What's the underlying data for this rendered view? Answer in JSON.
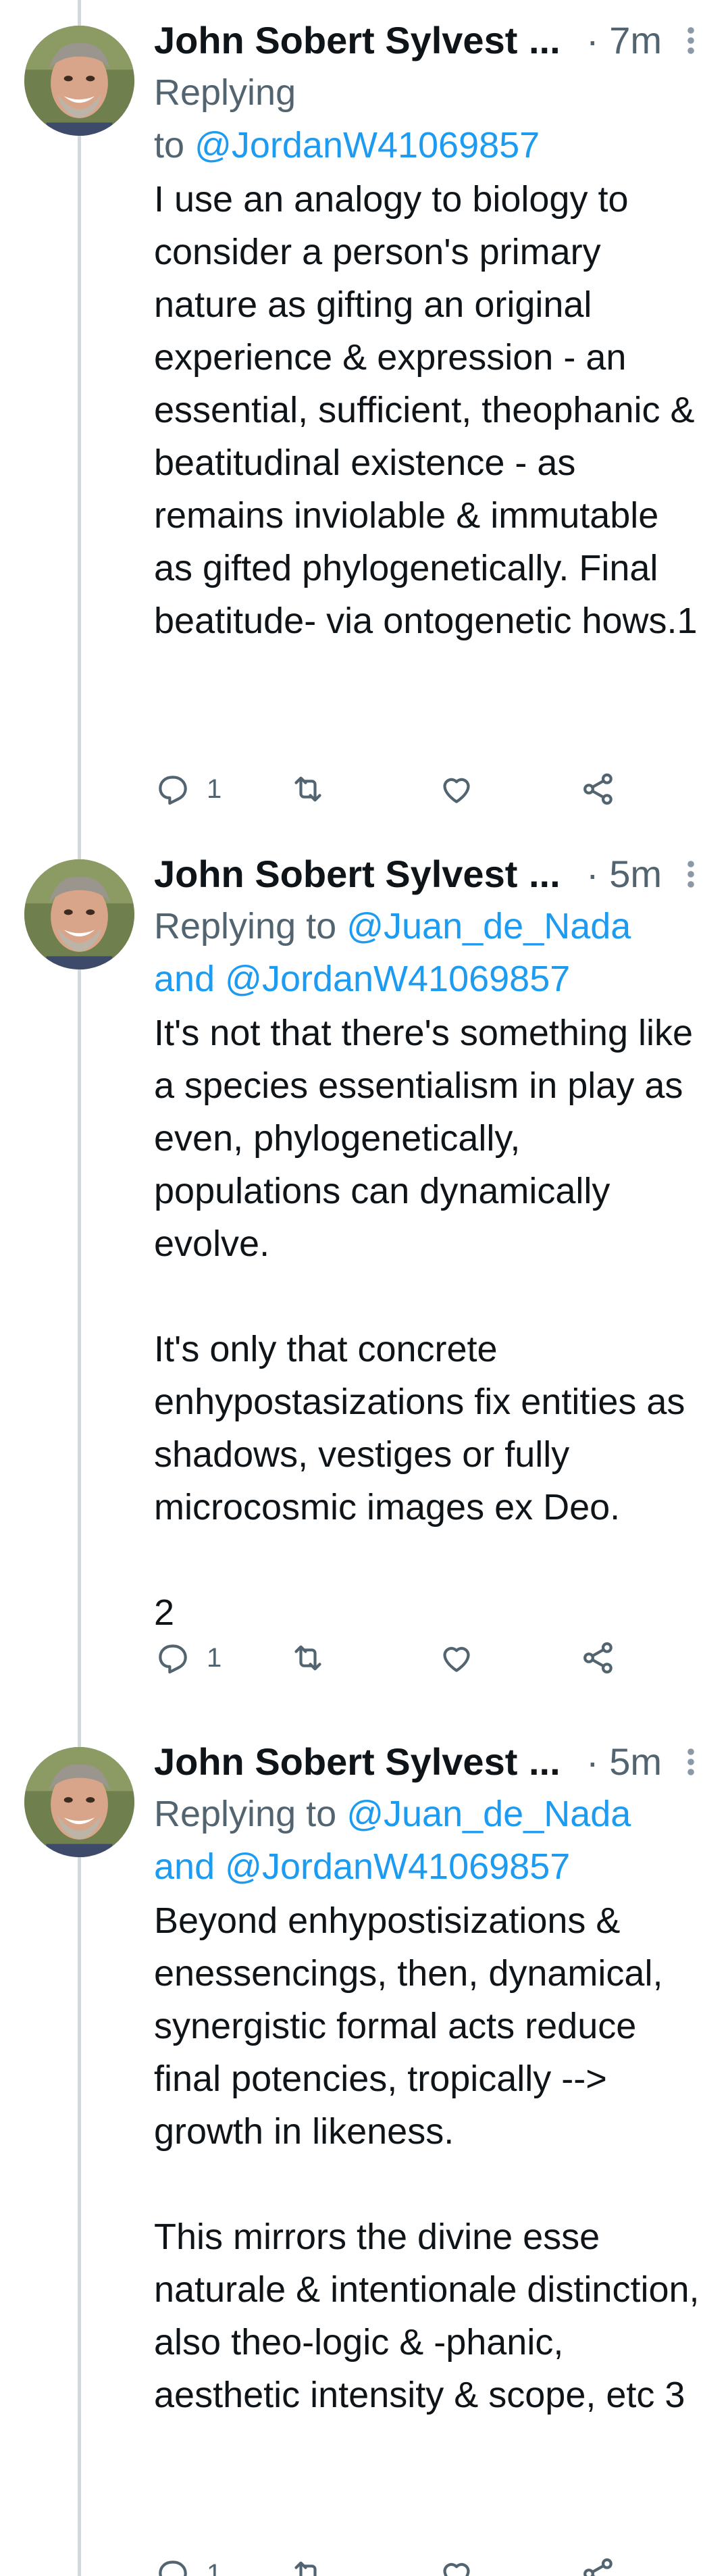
{
  "tweets": [
    {
      "author_name": "John Sobert Sylvest",
      "ellipsis": "...",
      "time": "· 7m",
      "reply_prefix": "Replying",
      "reply_to_word": "to",
      "reply_mention_1": "@JordanW41069857",
      "body": "I use an analogy to biology to consider a person's primary nature as gifting an original experience & expression - an essential, sufficient, theophanic & beatitudinal existence - as remains inviolable & immutable as gifted phylogenetically. Final beatitude- via ontogenetic hows.1",
      "reply_count": "1"
    },
    {
      "author_name": "John Sobert Sylvest",
      "ellipsis": "...",
      "time": "· 5m",
      "reply_prefix": "Replying to",
      "reply_mention_1": "@Juan_de_Nada",
      "reply_and": "and",
      "reply_mention_2": "@JordanW41069857",
      "body": "It's not that there's something like a species essentialism in play as even, phylogenetically, populations can dynamically evolve.\n\nIt's only that concrete enhypostasizations fix entities as shadows, vestiges or fully microcosmic images ex Deo.\n\n2",
      "reply_count": "1"
    },
    {
      "author_name": "John Sobert Sylvest",
      "ellipsis": "...",
      "time": "· 5m",
      "reply_prefix": "Replying to",
      "reply_mention_1": "@Juan_de_Nada",
      "reply_and": "and",
      "reply_mention_2": "@JordanW41069857",
      "body": "Beyond enhypostisizations & enessencings, then, dynamical, synergistic formal acts reduce final potencies, tropically --> growth in likeness.\n\nThis mirrors the divine esse naturale & intentionale distinction, also theo-logic & -phanic, aesthetic intensity & scope, etc 3",
      "reply_count": "1"
    }
  ],
  "icons": {
    "reply": "reply-icon",
    "retweet": "retweet-icon",
    "like": "like-icon",
    "share": "share-icon",
    "more": "more-icon"
  },
  "colors": {
    "text": "#0f1419",
    "secondary": "#536471",
    "mention": "#1d9bf0",
    "thread_line": "#cfd9de"
  }
}
